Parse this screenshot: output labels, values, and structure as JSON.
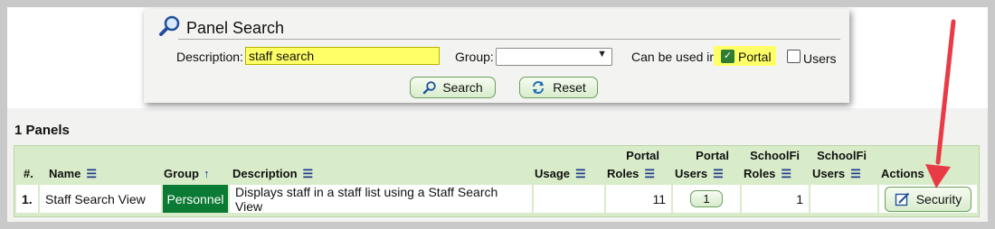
{
  "panel_search": {
    "title": "Panel Search",
    "description_label": "Description:",
    "description_value": "staff search",
    "group_label": "Group:",
    "group_value": "",
    "can_be_used_label": "Can be used in:",
    "portal_label": "Portal",
    "portal_checked": true,
    "users_label": "Users",
    "users_checked": false,
    "search_button": "Search",
    "reset_button": "Reset"
  },
  "results": {
    "count_title": "1 Panels",
    "headers": {
      "num": "#.",
      "name": "Name",
      "group": "Group",
      "description": "Description",
      "usage": "Usage",
      "portal_roles_1": "Portal",
      "portal_roles_2": "Roles",
      "portal_users_1": "Portal",
      "portal_users_2": "Users",
      "schoolfi_roles_1": "SchoolFi",
      "schoolfi_roles_2": "Roles",
      "schoolfi_users_1": "SchoolFi",
      "schoolfi_users_2": "Users",
      "actions": "Actions"
    },
    "rows": [
      {
        "num": "1.",
        "name": "Staff Search View",
        "group": "Personnel",
        "description": "Displays staff in a staff list using a Staff Search View",
        "usage": "",
        "portal_roles": "11",
        "portal_users": "1",
        "schoolfi_roles": "1",
        "schoolfi_users": "",
        "action": "Security"
      }
    ]
  },
  "colors": {
    "highlight": "#ffff66",
    "table_header_bg": "#d9ecc9",
    "group_badge": "#0b7a35",
    "button_border": "#6b9f5d",
    "annotation_arrow": "#e83b46"
  }
}
